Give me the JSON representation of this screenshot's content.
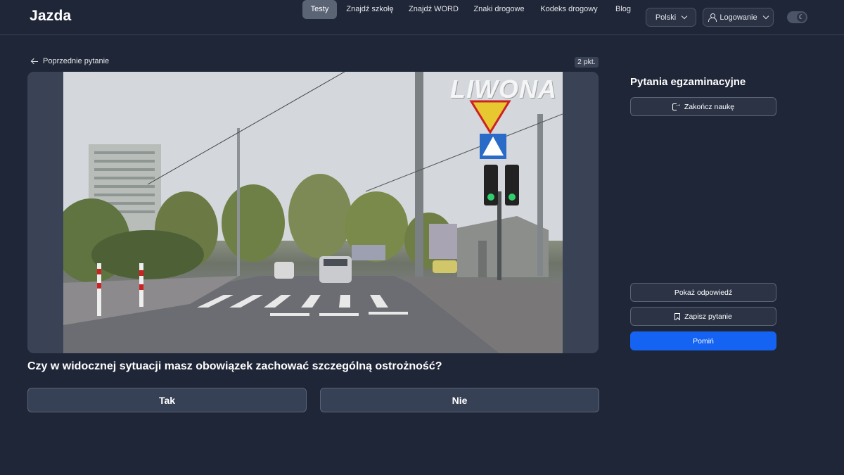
{
  "brand": {
    "logo_text": "Jazda"
  },
  "nav": {
    "items": [
      {
        "label": "Testy",
        "active": true
      },
      {
        "label": "Znajdź szkołę",
        "active": false
      },
      {
        "label": "Znajdź WORD",
        "active": false
      },
      {
        "label": "Znaki drogowe",
        "active": false
      },
      {
        "label": "Kodeks drogowy",
        "active": false
      },
      {
        "label": "Blog",
        "active": false
      }
    ],
    "language_label": "Polski",
    "login_label": "Logowanie",
    "theme_icon": "moon-icon"
  },
  "question": {
    "back_label": "Poprzednie pytanie",
    "points_label": "2 pkt.",
    "image_watermark": "LIWONA",
    "text": "Czy w widocznej sytuacji masz obowiązek zachować szczególną ostrożność?",
    "answers": [
      {
        "label": "Tak"
      },
      {
        "label": "Nie"
      }
    ]
  },
  "sidebar": {
    "title": "Pytania egzaminacyjne",
    "finish_label": "Zakończ naukę",
    "show_answer_label": "Pokaż odpowiedź",
    "save_label": "Zapisz pytanie",
    "skip_label": "Pomiń"
  },
  "colors": {
    "background": "#1f2637",
    "accent": "#1463f3",
    "panel": "#3a4356"
  }
}
